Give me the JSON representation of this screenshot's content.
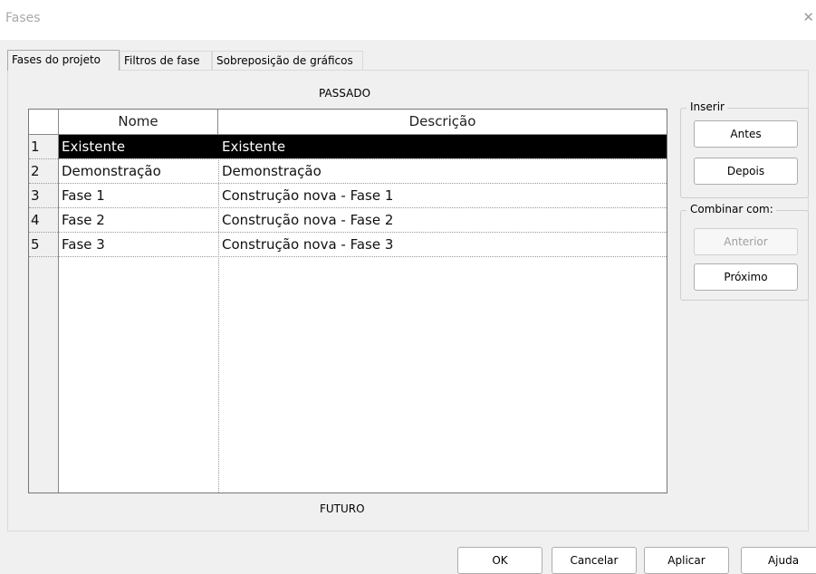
{
  "window": {
    "title": "Fases"
  },
  "tabs": [
    {
      "label": "Fases do projeto",
      "active": true
    },
    {
      "label": "Filtros de fase",
      "active": false
    },
    {
      "label": "Sobreposição de gráficos",
      "active": false
    }
  ],
  "grid": {
    "top_label": "PASSADO",
    "bottom_label": "FUTURO",
    "headers": {
      "name": "Nome",
      "description": "Descrição"
    },
    "rows": [
      {
        "num": "1",
        "name": "Existente",
        "description": "Existente",
        "selected": true
      },
      {
        "num": "2",
        "name": "Demonstração",
        "description": "Demonstração",
        "selected": false
      },
      {
        "num": "3",
        "name": "Fase 1",
        "description": "Construção nova - Fase 1",
        "selected": false
      },
      {
        "num": "4",
        "name": "Fase 2",
        "description": "Construção nova - Fase 2",
        "selected": false
      },
      {
        "num": "5",
        "name": "Fase 3",
        "description": "Construção nova - Fase 3",
        "selected": false
      }
    ]
  },
  "insert_group": {
    "title": "Inserir",
    "before_label": "Antes",
    "after_label": "Depois"
  },
  "combine_group": {
    "title": "Combinar com:",
    "previous_label": "Anterior",
    "next_label": "Próximo"
  },
  "footer": {
    "ok_label": "OK",
    "cancel_label": "Cancelar",
    "apply_label": "Aplicar",
    "help_label": "Ajuda"
  },
  "colors": {
    "selection_bg": "#000000",
    "selection_text": "#ffffff",
    "dialog_bg": "#f0f0f0"
  }
}
